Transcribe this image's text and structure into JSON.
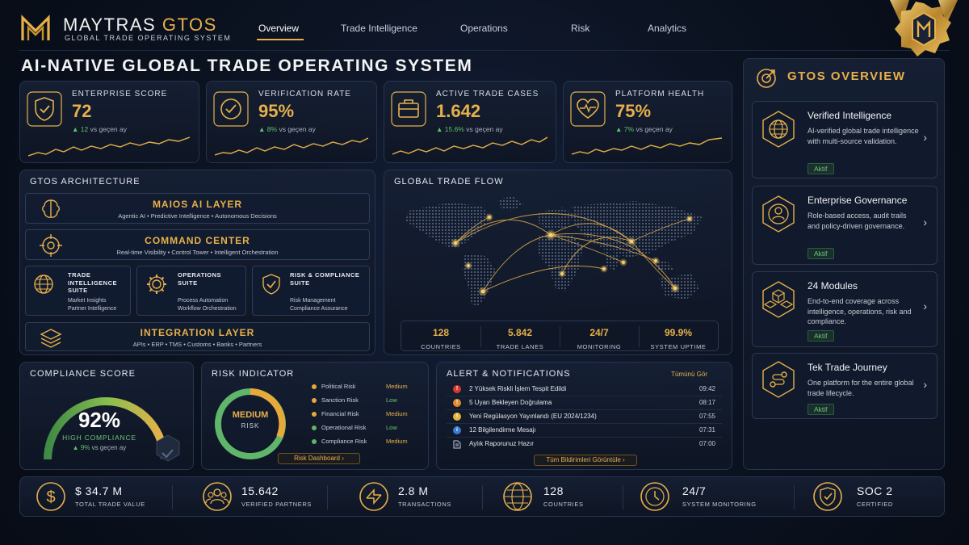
{
  "header": {
    "brand_main": "MAYTRAS",
    "brand_accent": "GTOS",
    "brand_sub": "GLOBAL TRADE OPERATING SYSTEM",
    "logo_letter": "M",
    "nav": [
      "Overview",
      "Trade Intelligence",
      "Operations",
      "Risk",
      "Analytics"
    ],
    "active_nav": "Overview"
  },
  "page_title": "AI-NATIVE GLOBAL TRADE OPERATING SYSTEM",
  "kpis": [
    {
      "label": "ENTERPRISE SCORE",
      "value": "72",
      "delta": "12",
      "delta_suffix": "vs geçen ay",
      "icon": "shield-check-icon"
    },
    {
      "label": "VERIFICATION RATE",
      "value": "95%",
      "delta": "8%",
      "delta_suffix": "vs geçen ay",
      "icon": "badge-check-icon"
    },
    {
      "label": "ACTIVE TRADE CASES",
      "value": "1.642",
      "delta": "15.6%",
      "delta_suffix": "vs geçen ay",
      "icon": "briefcase-icon"
    },
    {
      "label": "PLATFORM HEALTH",
      "value": "75%",
      "delta": "7%",
      "delta_suffix": "vs geçen ay",
      "icon": "heart-pulse-icon"
    }
  ],
  "architecture": {
    "title": "GTOS ARCHITECTURE",
    "maios": {
      "name": "MAIOS AI LAYER",
      "sub": "Agentic AI  •  Predictive Intelligence  •  Autonomous Decisions"
    },
    "command": {
      "name": "COMMAND CENTER",
      "sub": "Real-time Visibility  •  Control Tower  •  Intelligent Orchestration"
    },
    "suites": [
      {
        "name_lines": [
          "TRADE",
          "INTELLIGENCE",
          "SUITE"
        ],
        "sub_lines": [
          "Market Insights",
          "Partner Intelligence"
        ]
      },
      {
        "name_lines": [
          "OPERATIONS",
          "SUITE"
        ],
        "sub_lines": [
          "Process Automation",
          "Workflow Orchestration"
        ]
      },
      {
        "name_lines": [
          "RISK & COMPLIANCE",
          "SUITE"
        ],
        "sub_lines": [
          "Risk Management",
          "Compliance Assurance"
        ]
      }
    ],
    "integration": {
      "name": "INTEGRATION LAYER",
      "sub": "APIs  •  ERP  •  TMS  •  Customs  •  Banks  •  Partners"
    }
  },
  "trade_flow": {
    "title": "GLOBAL TRADE FLOW",
    "stats": [
      {
        "value": "128",
        "label": "COUNTRIES"
      },
      {
        "value": "5.842",
        "label": "TRADE LANES"
      },
      {
        "value": "24/7",
        "label": "MONITORING"
      },
      {
        "value": "99.9%",
        "label": "SYSTEM UPTIME"
      }
    ]
  },
  "overview": {
    "title": "GTOS OVERVIEW",
    "cards": [
      {
        "title": "Verified Intelligence",
        "desc": "AI-verified global trade intelligence with multi-source validation.",
        "badge": "Aktif",
        "icon": "globe-icon"
      },
      {
        "title": "Enterprise Governance",
        "desc": "Role-based access, audit trails and policy-driven governance.",
        "badge": "Aktif",
        "icon": "governance-icon"
      },
      {
        "title": "24 Modules",
        "desc": "End-to-end coverage across intelligence, operations, risk and compliance.",
        "badge": "Aktif",
        "icon": "modules-icon"
      },
      {
        "title": "Tek Trade Journey",
        "desc": "One platform for the entire global trade lifecycle.",
        "badge": "Aktif",
        "icon": "journey-icon"
      }
    ]
  },
  "compliance": {
    "title": "COMPLIANCE SCORE",
    "value": "92%",
    "level": 0.92,
    "status": "HIGH COMPLIANCE",
    "delta": "9%",
    "delta_suffix": "vs geçen ay"
  },
  "risk": {
    "title": "RISK INDICATOR",
    "level": "MEDIUM",
    "level_sub": "RISK",
    "items": [
      {
        "name": "Political Risk",
        "level": "Medium",
        "color": "#e7a93a"
      },
      {
        "name": "Sanction Risk",
        "level": "Low",
        "color": "#e7a93a"
      },
      {
        "name": "Financial Risk",
        "level": "Medium",
        "color": "#e7a93a"
      },
      {
        "name": "Operational Risk",
        "level": "Low",
        "color": "#5fb56a"
      },
      {
        "name": "Compliance Risk",
        "level": "Medium",
        "color": "#5fb56a"
      }
    ],
    "button": "Risk Dashboard"
  },
  "alerts": {
    "title": "ALERT & NOTIFICATIONS",
    "see_all": "Tümünü Gör",
    "items": [
      {
        "text": "2 Yüksek Riskli İşlem Tespit Edildi",
        "time": "09:42",
        "icon": "alert-red-icon",
        "color": "#d8372f",
        "glyph": "!"
      },
      {
        "text": "5 Uyarı Bekleyen Doğrulama",
        "time": "08:17",
        "icon": "alert-orange-icon",
        "color": "#e38b2c",
        "glyph": "!"
      },
      {
        "text": "Yeni Regülasyon Yayınlandı (EU 2024/1234)",
        "time": "07:55",
        "icon": "alert-yellow-icon",
        "color": "#e5b53a",
        "glyph": "!"
      },
      {
        "text": "12 Bilgilendirme Mesajı",
        "time": "07:31",
        "icon": "info-icon",
        "color": "#3a7bd5",
        "glyph": "i"
      },
      {
        "text": "Aylık Raporunuz Hazır",
        "time": "07:00",
        "icon": "document-icon",
        "color": "#7c8597",
        "glyph": ""
      }
    ],
    "button": "Tüm Bildirimleri Görüntüle"
  },
  "footer": [
    {
      "value": "$ 34.7 M",
      "label": "TOTAL TRADE VALUE",
      "icon": "dollar-icon"
    },
    {
      "value": "15.642",
      "label": "VERIFIED PARTNERS",
      "icon": "partners-icon"
    },
    {
      "value": "2.8 M",
      "label": "TRANSACTIONS",
      "icon": "transactions-icon"
    },
    {
      "value": "128",
      "label": "COUNTRIES",
      "icon": "globe-icon"
    },
    {
      "value": "24/7",
      "label": "SYSTEM MONITORING",
      "icon": "clock-icon"
    },
    {
      "value": "SOC 2",
      "label": "CERTIFIED",
      "icon": "shield-check-icon"
    }
  ],
  "colors": {
    "gold": "#e7b04a",
    "green": "#5fc16b",
    "bg": "#0b1220"
  }
}
